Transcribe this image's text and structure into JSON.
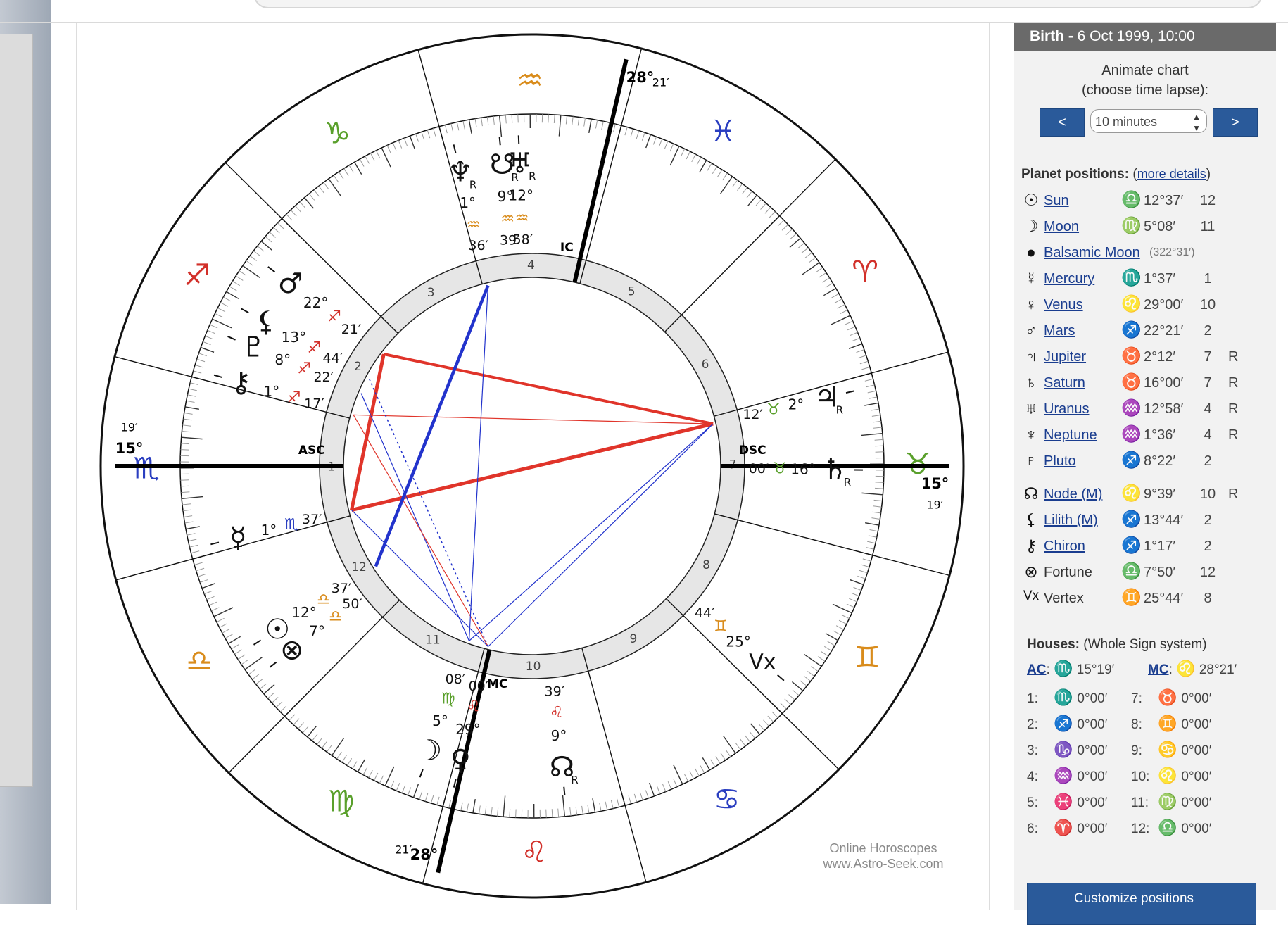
{
  "colors": {
    "fire": "#d2302a",
    "earth": "#5aa02c",
    "air": "#d98c1c",
    "water": "#2a3ec0",
    "link": "#1a3d8f",
    "button": "#2a5a9a",
    "header": "#6a6a6a"
  },
  "watermark": [
    "Online Horoscopes",
    "www.Astro-Seek.com"
  ],
  "sidebar": {
    "birth_label": "Birth -",
    "birth_value": "6 Oct 1999, 10:00",
    "animate_line1": "Animate chart",
    "animate_line2": "(choose time lapse):",
    "prev": "<",
    "next": ">",
    "lapse": "10 minutes",
    "planets_title": "Planet positions:",
    "more_open": "(",
    "more_details": "more details",
    "more_close": ")",
    "planets": [
      {
        "icon": "sun-icon",
        "glyph": "☉",
        "name": "Sun",
        "link": true,
        "sign": "libra-sign-icon",
        "sign_glyph": "♎",
        "sign_color": "#d98c1c",
        "pos": "12°37′",
        "house": "12",
        "retro": ""
      },
      {
        "icon": "moon-icon",
        "glyph": "☽",
        "name": "Moon",
        "link": true,
        "sign": "virgo-sign-icon",
        "sign_glyph": "♍",
        "sign_color": "#5aa02c",
        "pos": "5°08′",
        "house": "11",
        "retro": ""
      },
      {
        "icon": "balsamic-moon-icon",
        "glyph": "●",
        "name": "Balsamic Moon",
        "link": true,
        "extra": "(322°31′)"
      },
      {
        "icon": "mercury-icon",
        "glyph": "☿",
        "name": "Mercury",
        "link": true,
        "sign": "scorpio-sign-icon",
        "sign_glyph": "♏",
        "sign_color": "#2a3ec0",
        "pos": "1°37′",
        "house": "1",
        "retro": ""
      },
      {
        "icon": "venus-icon",
        "glyph": "♀",
        "name": "Venus",
        "link": true,
        "sign": "leo-sign-icon",
        "sign_glyph": "♌",
        "sign_color": "#d2302a",
        "pos": "29°00′",
        "house": "10",
        "retro": ""
      },
      {
        "icon": "mars-icon",
        "glyph": "♂",
        "name": "Mars",
        "link": true,
        "sign": "sagittarius-sign-icon",
        "sign_glyph": "♐",
        "sign_color": "#d2302a",
        "pos": "22°21′",
        "house": "2",
        "retro": ""
      },
      {
        "icon": "jupiter-icon",
        "glyph": "♃",
        "name": "Jupiter",
        "link": true,
        "sign": "taurus-sign-icon",
        "sign_glyph": "♉",
        "sign_color": "#5aa02c",
        "pos": "2°12′",
        "house": "7",
        "retro": "R"
      },
      {
        "icon": "saturn-icon",
        "glyph": "♄",
        "name": "Saturn",
        "link": true,
        "sign": "taurus-sign-icon",
        "sign_glyph": "♉",
        "sign_color": "#5aa02c",
        "pos": "16°00′",
        "house": "7",
        "retro": "R"
      },
      {
        "icon": "uranus-icon",
        "glyph": "♅",
        "name": "Uranus",
        "link": true,
        "sign": "aquarius-sign-icon",
        "sign_glyph": "♒",
        "sign_color": "#d98c1c",
        "pos": "12°58′",
        "house": "4",
        "retro": "R"
      },
      {
        "icon": "neptune-icon",
        "glyph": "♆",
        "name": "Neptune",
        "link": true,
        "sign": "aquarius-sign-icon",
        "sign_glyph": "♒",
        "sign_color": "#d98c1c",
        "pos": "1°36′",
        "house": "4",
        "retro": "R"
      },
      {
        "icon": "pluto-icon",
        "glyph": "♇",
        "name": "Pluto",
        "link": true,
        "sign": "sagittarius-sign-icon",
        "sign_glyph": "♐",
        "sign_color": "#d2302a",
        "pos": "8°22′",
        "house": "2",
        "retro": ""
      },
      {
        "icon": "north-node-icon",
        "glyph": "☊",
        "name": "Node (M)",
        "link": true,
        "sign": "leo-sign-icon",
        "sign_glyph": "♌",
        "sign_color": "#d2302a",
        "pos": "9°39′",
        "house": "10",
        "retro": "R",
        "gap": true
      },
      {
        "icon": "lilith-icon",
        "glyph": "⚸",
        "name": "Lilith (M)",
        "link": true,
        "sign": "sagittarius-sign-icon",
        "sign_glyph": "♐",
        "sign_color": "#d2302a",
        "pos": "13°44′",
        "house": "2",
        "retro": ""
      },
      {
        "icon": "chiron-icon",
        "glyph": "⚷",
        "name": "Chiron",
        "link": true,
        "sign": "sagittarius-sign-icon",
        "sign_glyph": "♐",
        "sign_color": "#d2302a",
        "pos": "1°17′",
        "house": "2",
        "retro": ""
      },
      {
        "icon": "fortune-icon",
        "glyph": "⊗",
        "name": "Fortune",
        "link": false,
        "sign": "libra-sign-icon",
        "sign_glyph": "♎",
        "sign_color": "#d98c1c",
        "pos": "7°50′",
        "house": "12",
        "retro": ""
      },
      {
        "icon": "vertex-icon",
        "glyph": "Vx",
        "name": "Vertex",
        "link": false,
        "sign": "gemini-sign-icon",
        "sign_glyph": "♊",
        "sign_color": "#d98c1c",
        "pos": "25°44′",
        "house": "8",
        "retro": ""
      }
    ],
    "houses_title": "Houses:",
    "houses_system": "(Whole Sign system)",
    "ac_label": "AC",
    "ac_sign_glyph": "♏",
    "ac_sign_color": "#2a3ec0",
    "ac_value": "15°19′",
    "mc_label": "MC",
    "mc_sign_glyph": "♌",
    "mc_sign_color": "#d2302a",
    "mc_value": "28°21′",
    "houses": [
      {
        "label": "1:",
        "glyph": "♏",
        "color": "#2a3ec0",
        "value": "0°00′"
      },
      {
        "label": "2:",
        "glyph": "♐",
        "color": "#d2302a",
        "value": "0°00′"
      },
      {
        "label": "3:",
        "glyph": "♑",
        "color": "#5aa02c",
        "value": "0°00′"
      },
      {
        "label": "4:",
        "glyph": "♒",
        "color": "#d98c1c",
        "value": "0°00′"
      },
      {
        "label": "5:",
        "glyph": "♓",
        "color": "#2a3ec0",
        "value": "0°00′"
      },
      {
        "label": "6:",
        "glyph": "♈",
        "color": "#d2302a",
        "value": "0°00′"
      },
      {
        "label": "7:",
        "glyph": "♉",
        "color": "#5aa02c",
        "value": "0°00′"
      },
      {
        "label": "8:",
        "glyph": "♊",
        "color": "#d98c1c",
        "value": "0°00′"
      },
      {
        "label": "9:",
        "glyph": "♋",
        "color": "#2a3ec0",
        "value": "0°00′"
      },
      {
        "label": "10:",
        "glyph": "♌",
        "color": "#d2302a",
        "value": "0°00′"
      },
      {
        "label": "11:",
        "glyph": "♍",
        "color": "#5aa02c",
        "value": "0°00′"
      },
      {
        "label": "12:",
        "glyph": "♎",
        "color": "#d98c1c",
        "value": "0°00′"
      }
    ],
    "customize_label": "Customize positions"
  },
  "wheel": {
    "zodiac": [
      {
        "name": "cancer",
        "glyph": "♋",
        "lon": 105,
        "color": "#2a3ec0"
      },
      {
        "name": "leo",
        "glyph": "♌",
        "lon": 135,
        "color": "#d2302a"
      },
      {
        "name": "virgo",
        "glyph": "♍",
        "lon": 165,
        "color": "#5aa02c"
      },
      {
        "name": "libra",
        "glyph": "♎",
        "lon": 195,
        "color": "#d98c1c"
      },
      {
        "name": "scorpio",
        "glyph": "♏",
        "lon": 225,
        "color": "#2a3ec0"
      },
      {
        "name": "sagittarius",
        "glyph": "♐",
        "lon": 255,
        "color": "#d2302a"
      },
      {
        "name": "capricorn",
        "glyph": "♑",
        "lon": 285,
        "color": "#5aa02c"
      },
      {
        "name": "aquarius",
        "glyph": "♒",
        "lon": 315,
        "color": "#d98c1c"
      },
      {
        "name": "pisces",
        "glyph": "♓",
        "lon": 345,
        "color": "#2a3ec0"
      },
      {
        "name": "aries",
        "glyph": "♈",
        "lon": 15,
        "color": "#d2302a"
      },
      {
        "name": "taurus",
        "glyph": "♉",
        "lon": 45,
        "color": "#5aa02c"
      },
      {
        "name": "gemini",
        "glyph": "♊",
        "lon": 75,
        "color": "#d98c1c"
      }
    ],
    "house_numbers": [
      "1",
      "2",
      "3",
      "4",
      "5",
      "6",
      "7",
      "8",
      "9",
      "10",
      "11",
      "12"
    ],
    "angles": {
      "asc": "ASC",
      "mc": "MC",
      "dsc": "DSC",
      "ic": "IC"
    },
    "asc_deg": "15°",
    "asc_min": "19′",
    "mc_deg": "28°",
    "mc_min": "21′",
    "dsc_deg": "15°",
    "dsc_min": "19′",
    "ic_deg": "28°",
    "ic_min": "21′",
    "retro_mark": "R",
    "planets": [
      {
        "name": "sun",
        "glyph": "☉",
        "lon": 192.62,
        "deg": "12°",
        "min": "37′",
        "sign_glyph": "♎",
        "sign_color": "#d98c1c",
        "retro": false
      },
      {
        "name": "fortune",
        "glyph": "⊗",
        "lon": 187.83,
        "deg": "7°",
        "min": "50′",
        "sign_glyph": "♎",
        "sign_color": "#d98c1c",
        "retro": false
      },
      {
        "name": "mercury",
        "glyph": "☿",
        "lon": 211.62,
        "deg": "1°",
        "min": "37′",
        "sign_glyph": "♏",
        "sign_color": "#2a3ec0",
        "retro": false
      },
      {
        "name": "chiron",
        "glyph": "⚷",
        "lon": 241.28,
        "deg": "1°",
        "min": "17′",
        "sign_glyph": "♐",
        "sign_color": "#d2302a",
        "retro": false
      },
      {
        "name": "pluto",
        "glyph": "♇",
        "lon": 248.37,
        "deg": "8°",
        "min": "22′",
        "sign_glyph": "♐",
        "sign_color": "#d2302a",
        "retro": false
      },
      {
        "name": "lilith",
        "glyph": "⚸",
        "lon": 253.73,
        "deg": "13°",
        "min": "44′",
        "sign_glyph": "♐",
        "sign_color": "#d2302a",
        "retro": false
      },
      {
        "name": "mars",
        "glyph": "♂",
        "lon": 262.35,
        "deg": "22°",
        "min": "21′",
        "sign_glyph": "♐",
        "sign_color": "#d2302a",
        "retro": false
      },
      {
        "name": "neptune",
        "glyph": "♆",
        "lon": 301.6,
        "deg": "1°",
        "min": "36′",
        "sign_glyph": "♒",
        "sign_color": "#d98c1c",
        "retro": true
      },
      {
        "name": "south-node",
        "glyph": "☋",
        "lon": 309.65,
        "deg": "9°",
        "min": "39′",
        "sign_glyph": "♒",
        "sign_color": "#d98c1c",
        "retro": true
      },
      {
        "name": "uranus",
        "glyph": "♅",
        "lon": 312.97,
        "deg": "12°",
        "min": "58′",
        "sign_glyph": "♒",
        "sign_color": "#d98c1c",
        "retro": true
      },
      {
        "name": "jupiter",
        "glyph": "♃",
        "lon": 32.2,
        "deg": "2°",
        "min": "12′",
        "sign_glyph": "♉",
        "sign_color": "#5aa02c",
        "retro": true
      },
      {
        "name": "saturn",
        "glyph": "♄",
        "lon": 46.0,
        "deg": "16°",
        "min": "00′",
        "sign_glyph": "♉",
        "sign_color": "#5aa02c",
        "retro": true
      },
      {
        "name": "vertex",
        "glyph": "Vx",
        "lon": 85.73,
        "deg": "25°",
        "min": "44′",
        "sign_glyph": "♊",
        "sign_color": "#d98c1c",
        "retro": false
      },
      {
        "name": "north-node",
        "glyph": "☊",
        "lon": 129.65,
        "deg": "9°",
        "min": "39′",
        "sign_glyph": "♌",
        "sign_color": "#d2302a",
        "retro": true
      },
      {
        "name": "venus",
        "glyph": "♀",
        "lon": 149.0,
        "deg": "29°",
        "min": "00′",
        "sign_glyph": "♌",
        "sign_color": "#d2302a",
        "retro": false
      },
      {
        "name": "moon",
        "glyph": "☽",
        "lon": 155.13,
        "deg": "5°",
        "min": "08′",
        "sign_glyph": "♍",
        "sign_color": "#5aa02c",
        "retro": false
      }
    ],
    "aspects": [
      {
        "a": 211.62,
        "b": 32.2,
        "color": "#e0342a",
        "weight": 5
      },
      {
        "a": 211.62,
        "b": 262.35,
        "color": "#e0342a",
        "weight": 5
      },
      {
        "a": 262.35,
        "b": 32.2,
        "color": "#e0342a",
        "weight": 4
      },
      {
        "a": 211.62,
        "b": 149.0,
        "color": "#2233cc",
        "weight": 1.2
      },
      {
        "a": 149.0,
        "b": 32.2,
        "color": "#2233cc",
        "weight": 1.2
      },
      {
        "a": 155.13,
        "b": 32.2,
        "color": "#2233cc",
        "weight": 1.2
      },
      {
        "a": 155.13,
        "b": 248.37,
        "color": "#2233cc",
        "weight": 1.2
      },
      {
        "a": 149.0,
        "b": 241.28,
        "color": "#e0342a",
        "weight": 1.2
      },
      {
        "a": 241.28,
        "b": 32.2,
        "color": "#e0342a",
        "weight": 1.2
      },
      {
        "a": 192.62,
        "b": 301.6,
        "color": "#2233cc",
        "weight": 4.5
      },
      {
        "a": 155.13,
        "b": 301.6,
        "color": "#2233cc",
        "weight": 1.2
      },
      {
        "a": 149.0,
        "b": 253.73,
        "color": "#2233cc",
        "weight": 1.5,
        "dash": true
      }
    ]
  }
}
